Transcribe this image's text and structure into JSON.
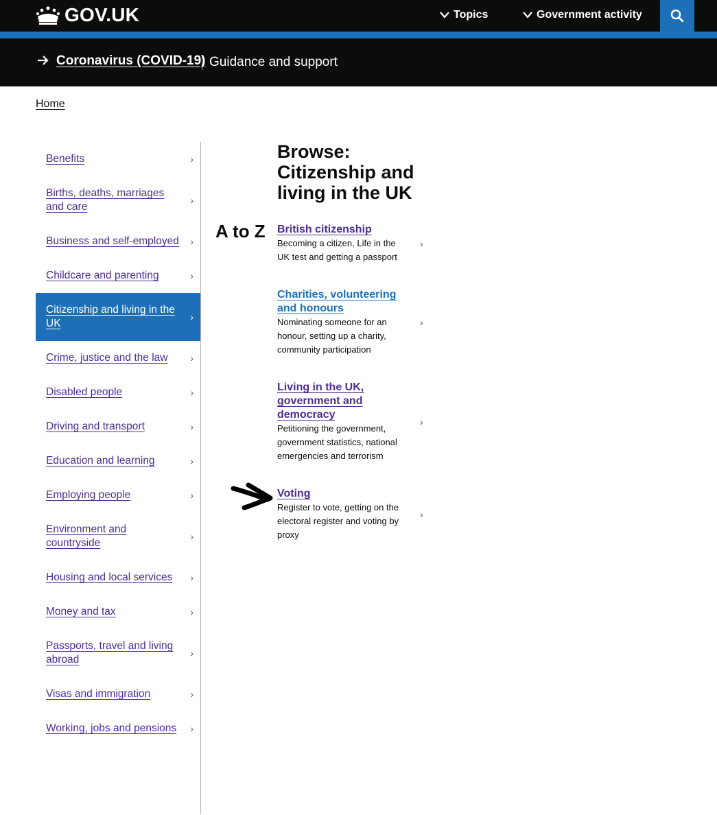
{
  "header": {
    "logo_text": "GOV.UK",
    "topics_label": "Topics",
    "gov_activity_label": "Government activity",
    "search_icon": "search-icon",
    "crown_icon": "crown-icon",
    "colors": {
      "header_bg": "#0b0c0c",
      "accent": "#1d70b8"
    }
  },
  "covid_banner": {
    "link": "Coronavirus (COVID-19)",
    "subtitle": "Guidance and support"
  },
  "breadcrumb": {
    "home": "Home"
  },
  "sidebar": {
    "items": [
      {
        "label": "Benefits"
      },
      {
        "label": "Births, deaths, marriages and care"
      },
      {
        "label": "Business and self-employed"
      },
      {
        "label": "Childcare and parenting"
      },
      {
        "label": "Citizenship and living in the UK",
        "active": true
      },
      {
        "label": "Crime, justice and the law"
      },
      {
        "label": "Disabled people"
      },
      {
        "label": "Driving and transport"
      },
      {
        "label": "Education and learning"
      },
      {
        "label": "Employing people"
      },
      {
        "label": "Environment and countryside"
      },
      {
        "label": "Housing and local services"
      },
      {
        "label": "Money and tax"
      },
      {
        "label": "Passports, travel and living abroad"
      },
      {
        "label": "Visas and immigration"
      },
      {
        "label": "Working, jobs and pensions"
      }
    ],
    "chevron": "›"
  },
  "atoz": "A to Z",
  "main": {
    "title": "Browse: Citizenship and living in the UK",
    "subsections": [
      {
        "title": "British citizenship",
        "desc": "Becoming a citizen, Life in the UK test and getting a passport"
      },
      {
        "title": "Charities, volunteering and honours",
        "desc": "Nominating someone for an honour, setting up a charity, community participation"
      },
      {
        "title": "Living in the UK, government and democracy",
        "desc": "Petitioning the government, government statistics, national emergencies and terrorism"
      },
      {
        "title": "Voting",
        "desc": "Register to vote, getting on the electoral register and voting by proxy"
      }
    ]
  }
}
